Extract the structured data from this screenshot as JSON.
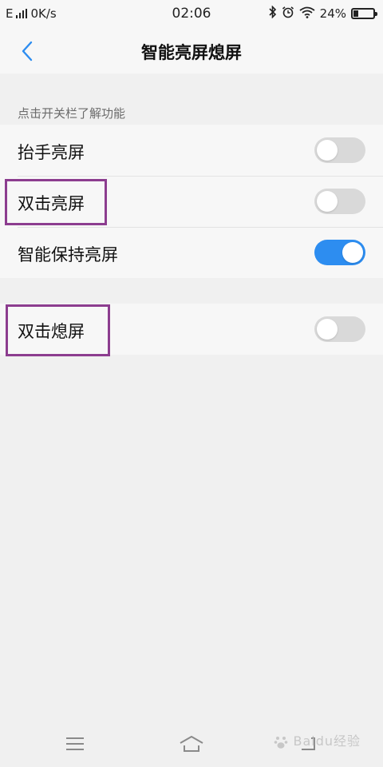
{
  "status_bar": {
    "network": "E",
    "speed": "0K/s",
    "time": "02:06",
    "battery_percent": "24%",
    "battery_level": 0.24,
    "icons": [
      "signal-icon",
      "bluetooth-icon",
      "alarm-icon",
      "wifi-icon",
      "battery-icon"
    ]
  },
  "header": {
    "title": "智能亮屏熄屏",
    "back_icon": "chevron-left-icon"
  },
  "section": {
    "caption": "点击开关栏了解功能"
  },
  "settings": [
    {
      "label": "抬手亮屏",
      "enabled": false
    },
    {
      "label": "双击亮屏",
      "enabled": false
    },
    {
      "label": "智能保持亮屏",
      "enabled": true
    }
  ],
  "settings_extra": [
    {
      "label": "双击熄屏",
      "enabled": false
    }
  ],
  "colors": {
    "accent": "#2d8df0",
    "highlight": "#8c3d8f",
    "toggle_off": "#d9d9d9"
  },
  "nav_bar": {
    "icons": [
      "menu-icon",
      "home-icon",
      "back-icon"
    ],
    "watermark": "Baidu经验"
  }
}
